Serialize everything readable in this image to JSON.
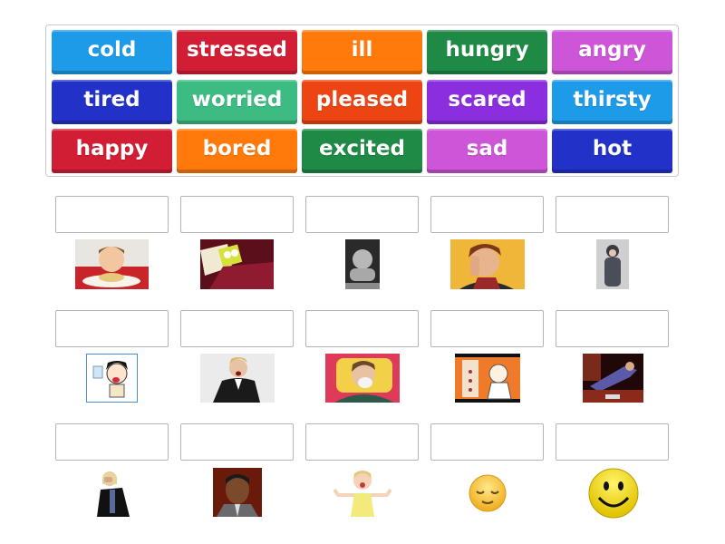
{
  "word_bank": {
    "tiles": [
      {
        "label": "cold",
        "color": "#1e9be8"
      },
      {
        "label": "stressed",
        "color": "#d21e34"
      },
      {
        "label": "ill",
        "color": "#ff7a0a"
      },
      {
        "label": "hungry",
        "color": "#1e8a46"
      },
      {
        "label": "angry",
        "color": "#cc55d8"
      },
      {
        "label": "tired",
        "color": "#2232c8"
      },
      {
        "label": "worried",
        "color": "#3cbc82"
      },
      {
        "label": "pleased",
        "color": "#ec4412"
      },
      {
        "label": "scared",
        "color": "#8a2ee0"
      },
      {
        "label": "thirsty",
        "color": "#1e9be8"
      },
      {
        "label": "happy",
        "color": "#d21e34"
      },
      {
        "label": "bored",
        "color": "#ff7a0a"
      },
      {
        "label": "excited",
        "color": "#1e8a46"
      },
      {
        "label": "sad",
        "color": "#cc55d8"
      },
      {
        "label": "hot",
        "color": "#2232c8"
      }
    ]
  },
  "answer_grid": {
    "items": [
      {
        "picture": "child-eating-spaghetti-photo",
        "answer": ""
      },
      {
        "picture": "spongebob-in-bed-photo",
        "answer": ""
      },
      {
        "picture": "baby-resting-chin-photo",
        "answer": ""
      },
      {
        "picture": "woman-hand-on-face-photo",
        "answer": ""
      },
      {
        "picture": "woman-in-winter-coat-photo",
        "answer": ""
      },
      {
        "picture": "cartoon-boy-with-water-glass",
        "answer": ""
      },
      {
        "picture": "woman-shouting-on-phone-photo",
        "answer": ""
      },
      {
        "picture": "man-blowing-nose-in-bed-photo",
        "answer": ""
      },
      {
        "picture": "cartoon-man-thermometer",
        "answer": ""
      },
      {
        "picture": "woman-lying-on-sofa-photo",
        "answer": ""
      },
      {
        "picture": "woman-covering-face-photo",
        "answer": ""
      },
      {
        "picture": "man-frowning-portrait-photo",
        "answer": ""
      },
      {
        "picture": "excited-toddler-photo",
        "answer": ""
      },
      {
        "picture": "relieved-face-emoji",
        "answer": ""
      },
      {
        "picture": "smiley-face-emoji",
        "answer": ""
      }
    ]
  }
}
